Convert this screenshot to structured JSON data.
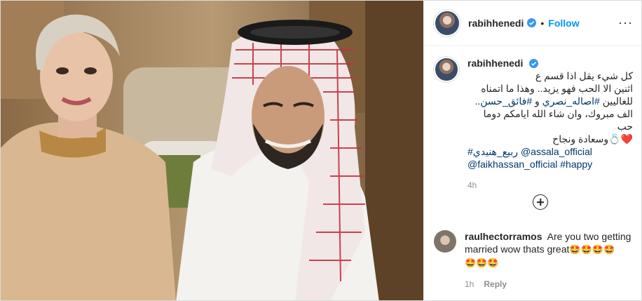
{
  "post": {
    "username": "rabihhenedi",
    "follow_label": "Follow",
    "dot": "•",
    "more": "···"
  },
  "caption": {
    "username": "rabihhenedi",
    "line1": "كل شيء يقل اذا قسم ع",
    "line2": "اثنين الا الحب فهو يزيد.. وهذا ما اتمناه",
    "line3_prefix": "للغاليين ",
    "hashtag1": "#اصاله_نصري",
    "line3_mid": " و ",
    "hashtag2": "#فائق_حسن",
    "line3_suffix": "..",
    "line4": "الف مبروك، وان شاء الله ايامكم دوما حب",
    "line5": "❤️💍وسعادة ونجاح",
    "hashtag3": "#ربيع_هنيدي",
    "mention1": "@assala_official",
    "mention2": "@faikhassan_official",
    "hashtag4": "#happy",
    "time": "4h"
  },
  "comment": {
    "username": "raulhectorramos",
    "text": "Are you two getting married wow thats great",
    "emojis1": "🤩🤩🤩🤩",
    "emojis2": "🤩🤩🤩",
    "time": "1h",
    "reply_label": "Reply"
  },
  "colors": {
    "accent": "#0095f6",
    "link": "#00376b",
    "muted": "#8e8e8e"
  }
}
